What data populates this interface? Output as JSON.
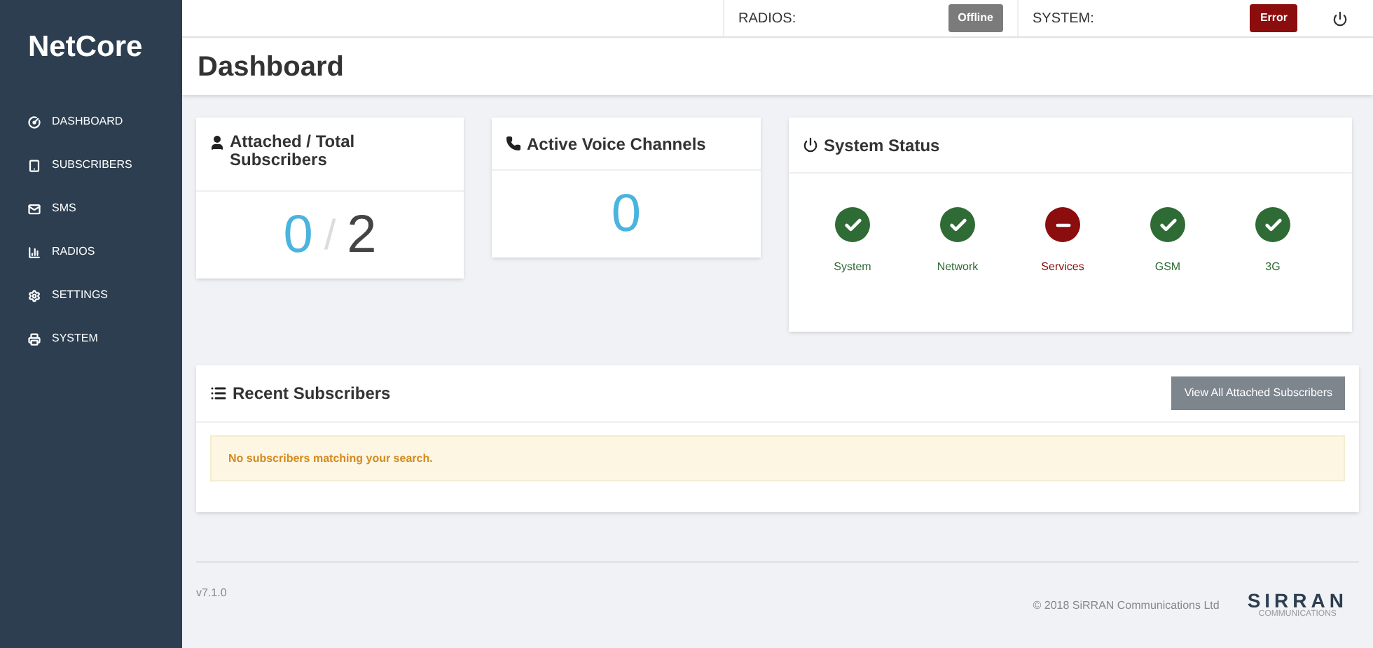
{
  "brand": "NetCore",
  "sidebar": {
    "items": [
      {
        "label": "DASHBOARD"
      },
      {
        "label": "SUBSCRIBERS"
      },
      {
        "label": "SMS"
      },
      {
        "label": "RADIOS"
      },
      {
        "label": "SETTINGS"
      },
      {
        "label": "SYSTEM"
      }
    ]
  },
  "topbar": {
    "indicators": [
      {
        "label": "RADIOS:",
        "badge": "Offline",
        "kind": "offline"
      },
      {
        "label": "SYSTEM:",
        "badge": "Error",
        "kind": "error"
      }
    ]
  },
  "page_title": "Dashboard",
  "subscribers_card": {
    "title": "Attached / Total Subscribers",
    "attached": "0",
    "separator": "/",
    "total": "2"
  },
  "voice_card": {
    "title": "Active Voice Channels",
    "value": "0"
  },
  "status_card": {
    "title": "System Status",
    "items": [
      {
        "label": "System",
        "kind": "ok"
      },
      {
        "label": "Network",
        "kind": "ok"
      },
      {
        "label": "Services",
        "kind": "error"
      },
      {
        "label": "GSM",
        "kind": "ok"
      },
      {
        "label": "3G",
        "kind": "ok"
      }
    ]
  },
  "recent": {
    "title": "Recent Subscribers",
    "button": "View All Attached Subscribers",
    "message": "No subscribers matching your search."
  },
  "footer": {
    "version": "v7.1.0",
    "copyright": "© 2018 SiRRAN Communications Ltd",
    "logo": "SIRRAN",
    "logo_sub": "COMMUNICATIONS"
  }
}
